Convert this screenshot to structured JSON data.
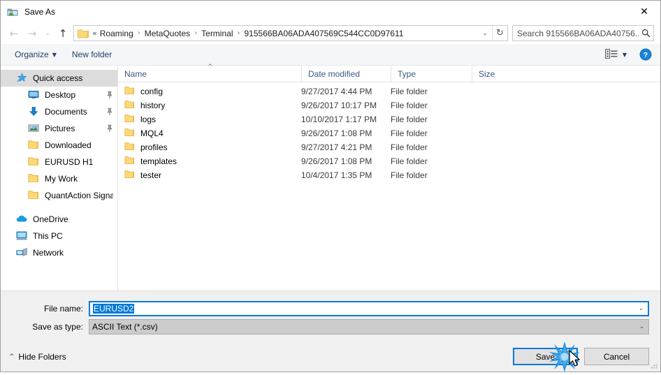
{
  "window": {
    "title": "Save As",
    "icon": "save-as-folder-person-icon",
    "close_label": "✕"
  },
  "nav": {
    "back_icon": "arrow-left-icon",
    "forward_icon": "arrow-right-icon",
    "recent_icon": "chevron-down-icon",
    "up_icon": "arrow-up-icon",
    "address": {
      "lead": "«",
      "crumbs": [
        "Roaming",
        "MetaQuotes",
        "Terminal",
        "915566BA06ADA407569C544CC0D97611"
      ],
      "separator": "›",
      "dropdown_icon": "chevron-down-icon",
      "refresh_icon": "refresh-icon"
    },
    "search": {
      "placeholder": "Search 915566BA06ADA40756...",
      "icon": "search-icon"
    }
  },
  "toolbar": {
    "organize_label": "Organize",
    "organize_caret": "▼",
    "new_folder_label": "New folder",
    "view_icon": "view-layout-icon",
    "view_caret": "▼",
    "help_icon": "help-icon",
    "help_label": "?"
  },
  "sidebar": {
    "items": [
      {
        "label": "Quick access",
        "icon": "quick-access-star-icon",
        "level": 0,
        "selected": true,
        "pinned": false
      },
      {
        "label": "Desktop",
        "icon": "desktop-monitor-icon",
        "level": 1,
        "selected": false,
        "pinned": true
      },
      {
        "label": "Documents",
        "icon": "documents-arrow-icon",
        "level": 1,
        "selected": false,
        "pinned": true
      },
      {
        "label": "Pictures",
        "icon": "pictures-icon",
        "level": 1,
        "selected": false,
        "pinned": true
      },
      {
        "label": "Downloaded",
        "icon": "folder-icon",
        "level": 1,
        "selected": false,
        "pinned": false
      },
      {
        "label": "EURUSD H1",
        "icon": "folder-icon",
        "level": 1,
        "selected": false,
        "pinned": false
      },
      {
        "label": "My Work",
        "icon": "folder-icon",
        "level": 1,
        "selected": false,
        "pinned": false
      },
      {
        "label": "QuantAction Signal",
        "icon": "folder-icon",
        "level": 1,
        "selected": false,
        "pinned": false
      },
      {
        "label": "OneDrive",
        "icon": "onedrive-cloud-icon",
        "level": 0,
        "selected": false,
        "pinned": false
      },
      {
        "label": "This PC",
        "icon": "this-pc-icon",
        "level": 0,
        "selected": false,
        "pinned": false
      },
      {
        "label": "Network",
        "icon": "network-icon",
        "level": 0,
        "selected": false,
        "pinned": false
      }
    ]
  },
  "filelist": {
    "columns": [
      "Name",
      "Date modified",
      "Type",
      "Size"
    ],
    "sort_indicator": "^",
    "rows": [
      {
        "name": "config",
        "date": "9/27/2017 4:44 PM",
        "type": "File folder",
        "size": ""
      },
      {
        "name": "history",
        "date": "9/26/2017 10:17 PM",
        "type": "File folder",
        "size": ""
      },
      {
        "name": "logs",
        "date": "10/10/2017 1:17 PM",
        "type": "File folder",
        "size": ""
      },
      {
        "name": "MQL4",
        "date": "9/26/2017 1:08 PM",
        "type": "File folder",
        "size": ""
      },
      {
        "name": "profiles",
        "date": "9/27/2017 4:21 PM",
        "type": "File folder",
        "size": ""
      },
      {
        "name": "templates",
        "date": "9/26/2017 1:08 PM",
        "type": "File folder",
        "size": ""
      },
      {
        "name": "tester",
        "date": "10/4/2017 1:35 PM",
        "type": "File folder",
        "size": ""
      }
    ]
  },
  "form": {
    "filename_label": "File name:",
    "filename_value": "EURUSD2",
    "filename_selected": true,
    "filetype_label": "Save as type:",
    "filetype_value": "ASCII Text (*.csv)",
    "dropdown_icon": "chevron-down-icon"
  },
  "footer": {
    "hide_folders_label": "Hide Folders",
    "hide_folders_caret": "^",
    "save_label": "Save",
    "cancel_label": "Cancel",
    "resize_grip_icon": "resize-grip-icon",
    "click_effect_icon": "click-burst-icon",
    "cursor_icon": "mouse-pointer-icon"
  },
  "colors": {
    "accent": "#0078d7",
    "folder": "#fcd975",
    "selection": "#dcdcdc",
    "chrome": "#f0f0f0"
  }
}
